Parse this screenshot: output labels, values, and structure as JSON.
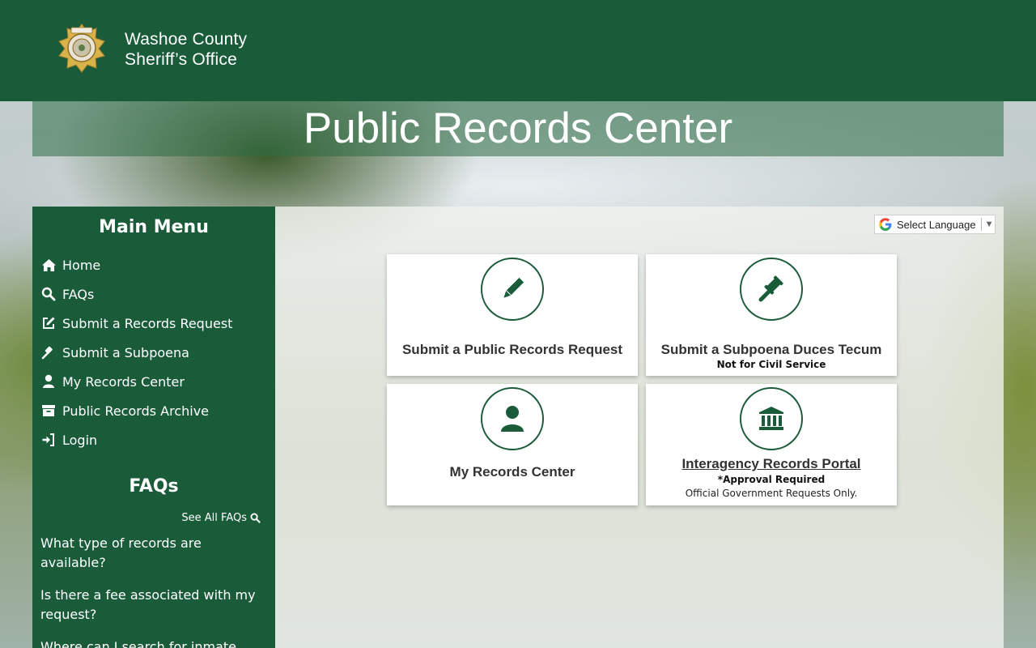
{
  "header": {
    "site_name_line1": "Washoe County",
    "site_name_line2": "Sheriff’s Office",
    "background_color": "#1a5c3a"
  },
  "banner": {
    "title": "Public Records Center"
  },
  "sidebar": {
    "menu_title": "Main Menu",
    "items": [
      {
        "label": "Home",
        "icon": "home-icon"
      },
      {
        "label": "FAQs",
        "icon": "search-icon"
      },
      {
        "label": "Submit a Records Request",
        "icon": "edit-icon"
      },
      {
        "label": "Submit a Subpoena",
        "icon": "gavel-icon"
      },
      {
        "label": "My Records Center",
        "icon": "user-icon"
      },
      {
        "label": "Public Records Archive",
        "icon": "archive-icon"
      },
      {
        "label": "Login",
        "icon": "sign-in-icon"
      }
    ],
    "faq_title": "FAQs",
    "see_all_label": "See All FAQs",
    "faq_items": [
      "What type of records are available?",
      "Is there a fee associated with my request?",
      "Where can I search for inmate"
    ]
  },
  "language": {
    "label": "Select Language",
    "arrow": "▼"
  },
  "cards": [
    {
      "title": "Submit a Public Records Request",
      "icon": "pencil-icon"
    },
    {
      "title": "Submit a Subpoena Duces Tecum",
      "subtitle": "Not for Civil Service",
      "icon": "gavel-icon"
    },
    {
      "title": "My Records Center",
      "icon": "user-icon"
    },
    {
      "title": "Interagency Records Portal",
      "subtitle": "*Approval Required",
      "note": "Official Government Requests Only.",
      "icon": "institution-icon"
    }
  ],
  "colors": {
    "accent": "#1a5c3a",
    "card_bg": "#ffffff",
    "text_dark": "#333333"
  }
}
